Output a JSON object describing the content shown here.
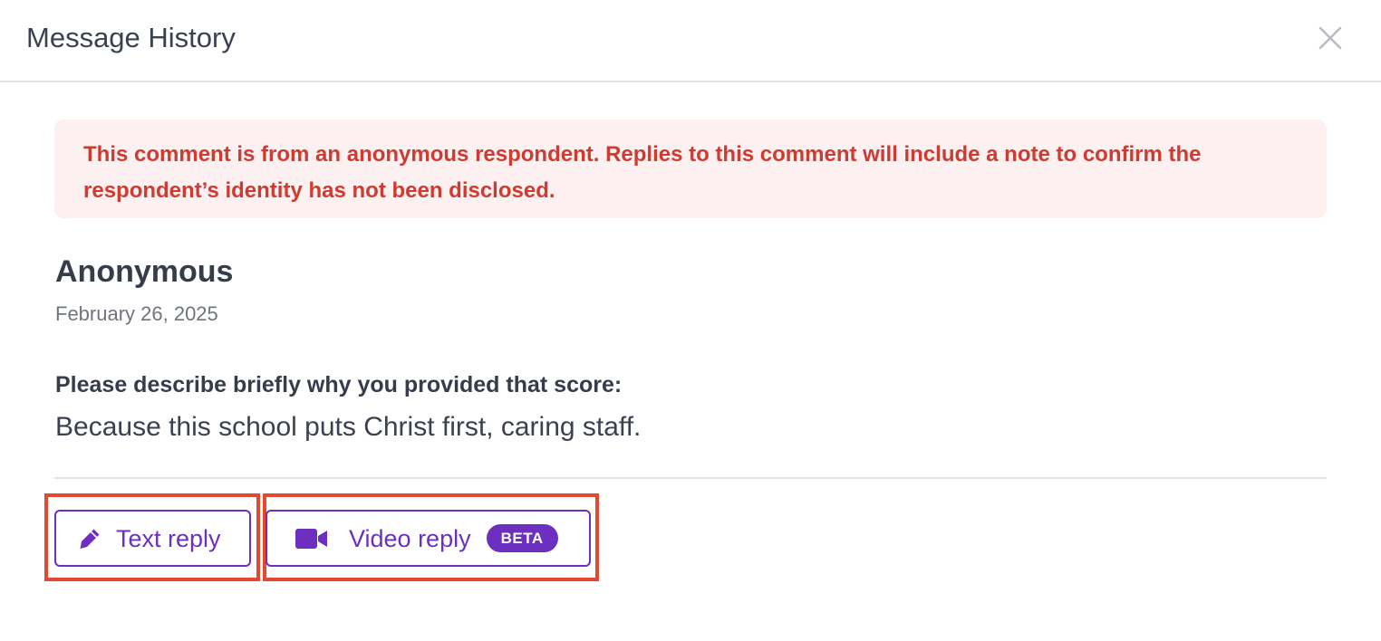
{
  "modal": {
    "title": "Message History",
    "close_icon": "close-icon"
  },
  "notice": {
    "text": "This comment is from an anonymous respondent. Replies to this comment will include a note to confirm the respondent’s identity has not been disclosed.",
    "text_color": "#cd3b31",
    "background": "#fcf0f0"
  },
  "comment": {
    "author": "Anonymous",
    "date": "February 26, 2025",
    "question": "Please describe briefly why you provided that score:",
    "answer": "Because this school puts Christ first, caring staff."
  },
  "actions": {
    "text_reply": {
      "label": "Text reply",
      "icon": "pencil-icon"
    },
    "video_reply": {
      "label": "Video reply",
      "icon": "video-camera-icon",
      "badge": "BETA"
    },
    "accent_color": "#6c2fbf",
    "highlight_color": "#e14a2f"
  }
}
